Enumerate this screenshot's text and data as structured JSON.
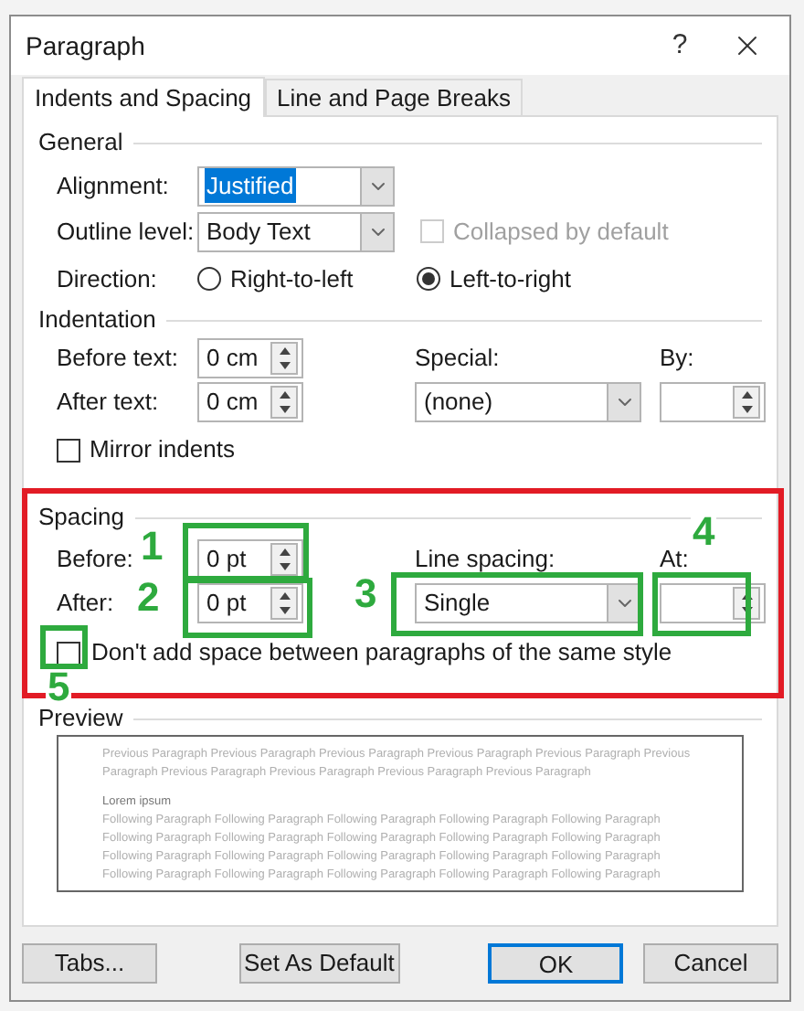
{
  "window": {
    "title": "Paragraph",
    "help": "?"
  },
  "tabs": [
    {
      "label": "Indents and Spacing",
      "selected": true
    },
    {
      "label": "Line and Page Breaks",
      "selected": false
    }
  ],
  "general": {
    "heading": "General",
    "alignment": {
      "label": "Alignment:",
      "value": "Justified",
      "text_selected": true
    },
    "outline_level": {
      "label": "Outline level:",
      "value": "Body Text",
      "text_selected": false
    },
    "collapsed": {
      "label": "Collapsed by default",
      "checked": false,
      "disabled": true
    },
    "direction": {
      "label": "Direction:",
      "options": [
        {
          "label": "Right-to-left",
          "selected": false
        },
        {
          "label": "Left-to-right",
          "selected": true
        }
      ]
    }
  },
  "indentation": {
    "heading": "Indentation",
    "before_text": {
      "label": "Before text:",
      "value": "0 cm"
    },
    "after_text": {
      "label": "After text:",
      "value": "0 cm"
    },
    "special": {
      "label": "Special:",
      "value": "(none)"
    },
    "by": {
      "label": "By:"
    },
    "mirror": {
      "label": "Mirror indents",
      "checked": false
    }
  },
  "spacing": {
    "heading": "Spacing",
    "before": {
      "label": "Before:",
      "value": "0 pt"
    },
    "after": {
      "label": "After:",
      "value": "0 pt"
    },
    "line_spacing": {
      "label": "Line spacing:",
      "value": "Single"
    },
    "at": {
      "label": "At:"
    },
    "dont_add": {
      "label": "Don't add space between paragraphs of the same style",
      "checked": false
    }
  },
  "preview": {
    "heading": "Preview",
    "previous": [
      "Previous Paragraph Previous Paragraph Previous Paragraph Previous Paragraph Previous Paragraph Previous",
      "Paragraph Previous Paragraph Previous Paragraph Previous Paragraph Previous Paragraph"
    ],
    "sample": "Lorem ipsum",
    "following": [
      "Following Paragraph Following Paragraph Following Paragraph Following Paragraph Following Paragraph",
      "Following Paragraph Following Paragraph Following Paragraph Following Paragraph Following Paragraph",
      "Following Paragraph Following Paragraph Following Paragraph Following Paragraph Following Paragraph",
      "Following Paragraph Following Paragraph Following Paragraph Following Paragraph Following Paragraph"
    ]
  },
  "buttons": [
    {
      "label": "Tabs...",
      "default": false
    },
    {
      "label": "Set As Default",
      "default": false
    },
    {
      "label": "OK",
      "default": true
    },
    {
      "label": "Cancel",
      "default": false
    }
  ],
  "annotations": [
    {
      "number": "1"
    },
    {
      "number": "2"
    },
    {
      "number": "3"
    },
    {
      "number": "4"
    },
    {
      "number": "5"
    }
  ]
}
